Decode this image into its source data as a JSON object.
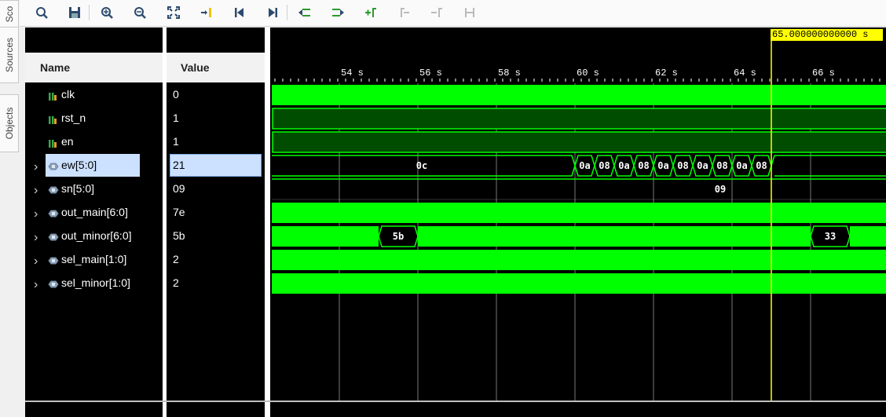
{
  "side_tabs": [
    "Sco",
    "Sources",
    "Objects"
  ],
  "toolbar": {
    "buttons": [
      "search-icon",
      "save-icon",
      "zoom-in-icon",
      "zoom-out-icon",
      "zoom-fit-icon",
      "go-to-cursor-icon",
      "go-to-start-icon",
      "go-to-end-icon",
      "previous-transition-icon",
      "next-transition-icon",
      "add-marker-icon",
      "previous-marker-icon",
      "next-marker-icon",
      "swap-cursors-icon"
    ]
  },
  "columns": {
    "name": "Name",
    "value": "Value"
  },
  "signals": [
    {
      "name": "clk",
      "value": "0",
      "type": "bit"
    },
    {
      "name": "rst_n",
      "value": "1",
      "type": "bit"
    },
    {
      "name": "en",
      "value": "1",
      "type": "bit"
    },
    {
      "name": "ew[5:0]",
      "value": "21",
      "type": "bus",
      "selected": true
    },
    {
      "name": "sn[5:0]",
      "value": "09",
      "type": "bus"
    },
    {
      "name": "out_main[6:0]",
      "value": "7e",
      "type": "bus"
    },
    {
      "name": "out_minor[6:0]",
      "value": "5b",
      "type": "bus"
    },
    {
      "name": "sel_main[1:0]",
      "value": "2",
      "type": "bus"
    },
    {
      "name": "sel_minor[1:0]",
      "value": "2",
      "type": "bus"
    }
  ],
  "timeline": {
    "ticks": [
      "54 s",
      "56 s",
      "58 s",
      "60 s",
      "62 s",
      "64 s",
      "66 s"
    ],
    "cursor_label": "65.000000000000 s"
  },
  "wave_labels": {
    "ew_initial": "0c",
    "ew_seq": [
      "0a",
      "08",
      "0a",
      "08",
      "0a",
      "08",
      "0a",
      "08",
      "0a",
      "08"
    ],
    "sn": "09",
    "out_minor_a": "5b",
    "out_minor_b": "33"
  },
  "colors": {
    "wave_green": "#00ff00",
    "dark_green": "#004d00",
    "cursor": "#ffff00",
    "select": "#cce0ff"
  }
}
